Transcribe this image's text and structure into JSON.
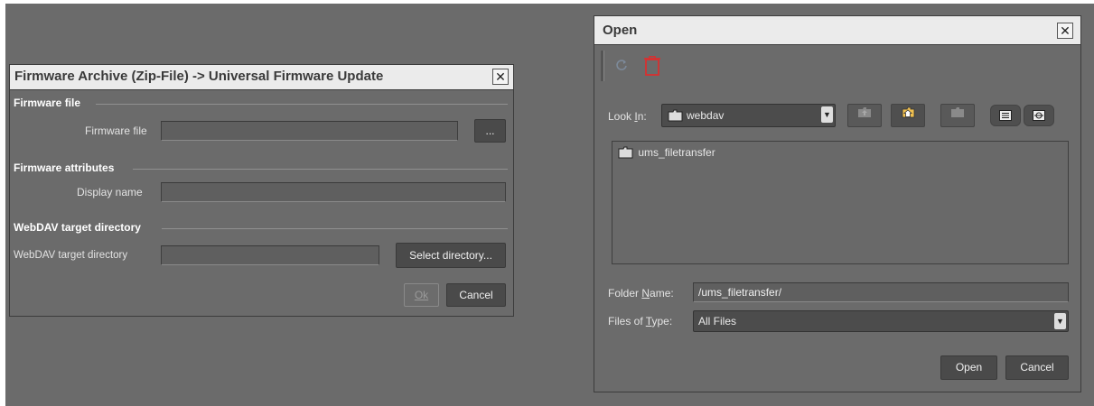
{
  "firmware_dialog": {
    "title": "Firmware Archive (Zip-File) -> Universal Firmware Update",
    "close_glyph": "✕",
    "sections": {
      "firmware_file": "Firmware file",
      "firmware_attributes": "Firmware attributes",
      "webdav": "WebDAV target directory"
    },
    "fields": {
      "firmware_file_label": "Firmware file",
      "firmware_file_value": "",
      "browse_label": "...",
      "display_name_label": "Display name",
      "display_name_value": "",
      "webdav_label": "WebDAV target directory",
      "webdav_value": "",
      "select_directory_label": "Select directory..."
    },
    "buttons": {
      "ok_label": "Ok",
      "cancel_label": "Cancel"
    }
  },
  "open_dialog": {
    "title": "Open",
    "close_glyph": "✕",
    "toolbar": {
      "refresh_icon": "refresh-icon",
      "delete_icon": "delete-icon"
    },
    "look_in": {
      "label_pre": "Look ",
      "label_mnemonic": "I",
      "label_post": "n:",
      "value": "webdav"
    },
    "nav_icons": [
      "up-folder-icon",
      "home-icon",
      "new-folder-icon",
      "list-view-icon",
      "details-view-icon"
    ],
    "files": [
      {
        "name": "ums_filetransfer",
        "type": "folder"
      }
    ],
    "folder_name": {
      "label_pre": "Folder ",
      "label_mnemonic": "N",
      "label_post": "ame:",
      "value": "/ums_filetransfer/"
    },
    "files_of_type": {
      "label_pre": "Files of ",
      "label_mnemonic": "T",
      "label_post": "ype:",
      "value": "All Files"
    },
    "buttons": {
      "open_label": "Open",
      "cancel_label": "Cancel"
    }
  },
  "colors": {
    "background": "#6b6b6b",
    "titlebar": "#ebebeb",
    "button": "#4a4a4a",
    "delete_icon": "#d83030"
  }
}
